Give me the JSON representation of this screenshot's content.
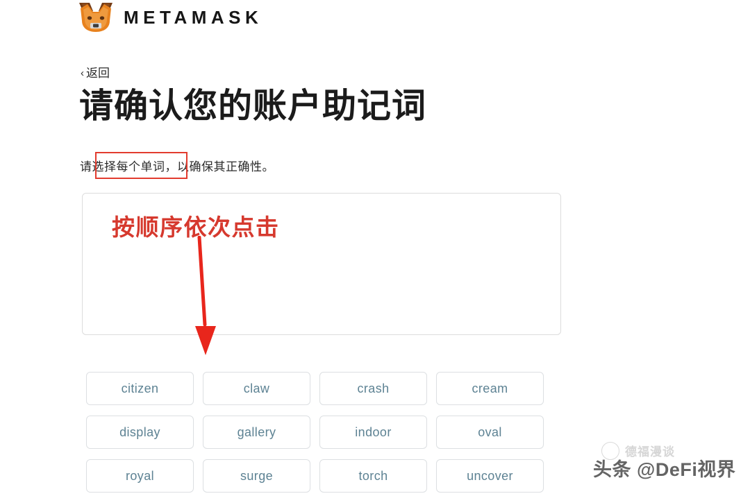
{
  "brand": {
    "wordmark": "METAMASK",
    "logo_icon": "metamask-fox-icon",
    "fox_face_color": "#e8821e",
    "fox_ear_color": "#763d16",
    "fox_snout_color": "#cdcdcd"
  },
  "nav": {
    "back_label": "返回",
    "back_chevron": "‹"
  },
  "page": {
    "title": "请确认您的账户助记词",
    "subtitle": "请选择每个单词，以确保其正确性。"
  },
  "annotations": {
    "highlight_box_color": "#e23b2e",
    "arrow_color": "#e8261c",
    "callout_text": "按顺序依次点击",
    "callout_color": "#d6392e"
  },
  "selection_area": {
    "selected_words": [],
    "border_color": "#dcdcdc"
  },
  "word_bank": {
    "word_text_color": "#5d8293",
    "words": [
      "citizen",
      "claw",
      "crash",
      "cream",
      "display",
      "gallery",
      "indoor",
      "oval",
      "royal",
      "surge",
      "torch",
      "uncover"
    ]
  },
  "watermark": {
    "main_text": "头条 @DeFi视界",
    "sub_text": "德福漫谈"
  }
}
